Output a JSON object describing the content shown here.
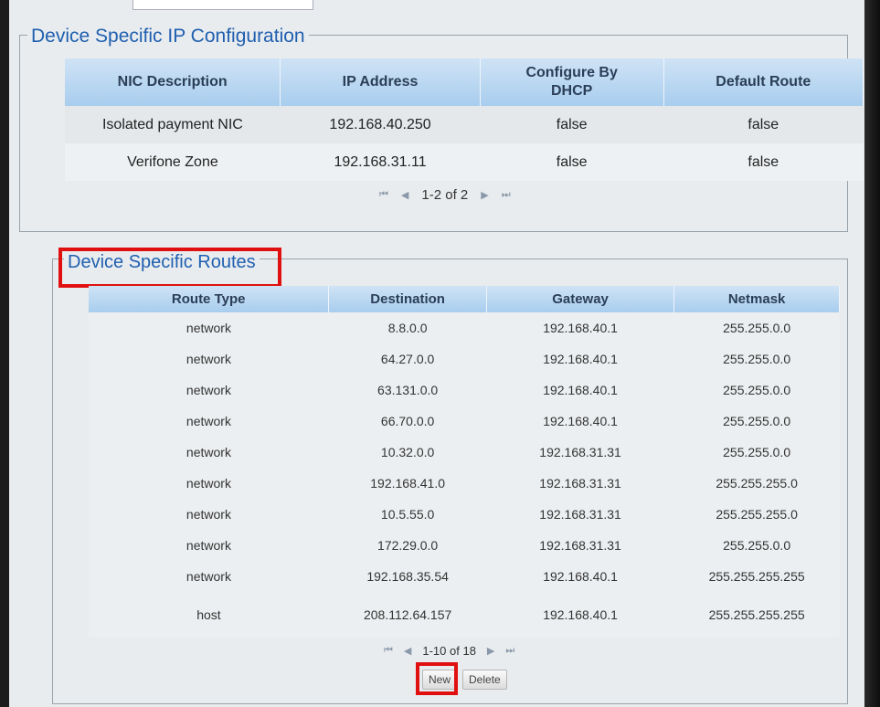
{
  "ip_config": {
    "legend": "Device Specific IP Configuration",
    "columns": [
      "NIC Description",
      "IP Address",
      "Configure By DHCP",
      "Default Route"
    ],
    "rows": [
      [
        "Isolated payment NIC",
        "192.168.40.250",
        "false",
        "false"
      ],
      [
        "Verifone Zone",
        "192.168.31.11",
        "false",
        "false"
      ]
    ],
    "pager": {
      "first": "⏮",
      "prev": "◀",
      "text": "1-2 of 2",
      "next": "▶",
      "last": "⏭"
    }
  },
  "routes": {
    "legend": "Device Specific Routes",
    "columns": [
      "Route Type",
      "Destination",
      "Gateway",
      "Netmask"
    ],
    "rows": [
      [
        "network",
        "8.8.0.0",
        "192.168.40.1",
        "255.255.0.0"
      ],
      [
        "network",
        "64.27.0.0",
        "192.168.40.1",
        "255.255.0.0"
      ],
      [
        "network",
        "63.131.0.0",
        "192.168.40.1",
        "255.255.0.0"
      ],
      [
        "network",
        "66.70.0.0",
        "192.168.40.1",
        "255.255.0.0"
      ],
      [
        "network",
        "10.32.0.0",
        "192.168.31.31",
        "255.255.0.0"
      ],
      [
        "network",
        "192.168.41.0",
        "192.168.31.31",
        "255.255.255.0"
      ],
      [
        "network",
        "10.5.55.0",
        "192.168.31.31",
        "255.255.255.0"
      ],
      [
        "network",
        "172.29.0.0",
        "192.168.31.31",
        "255.255.0.0"
      ],
      [
        "network",
        "192.168.35.54",
        "192.168.40.1",
        "255.255.255.255"
      ],
      [
        "host",
        "208.112.64.157",
        "192.168.40.1",
        "255.255.255.255"
      ]
    ],
    "pager": {
      "first": "⏮",
      "prev": "◀",
      "text": "1-10 of 18",
      "next": "▶",
      "last": "⏭"
    },
    "actions": {
      "new_label": "New",
      "delete_label": "Delete"
    }
  },
  "highlight_color": "#e01010"
}
